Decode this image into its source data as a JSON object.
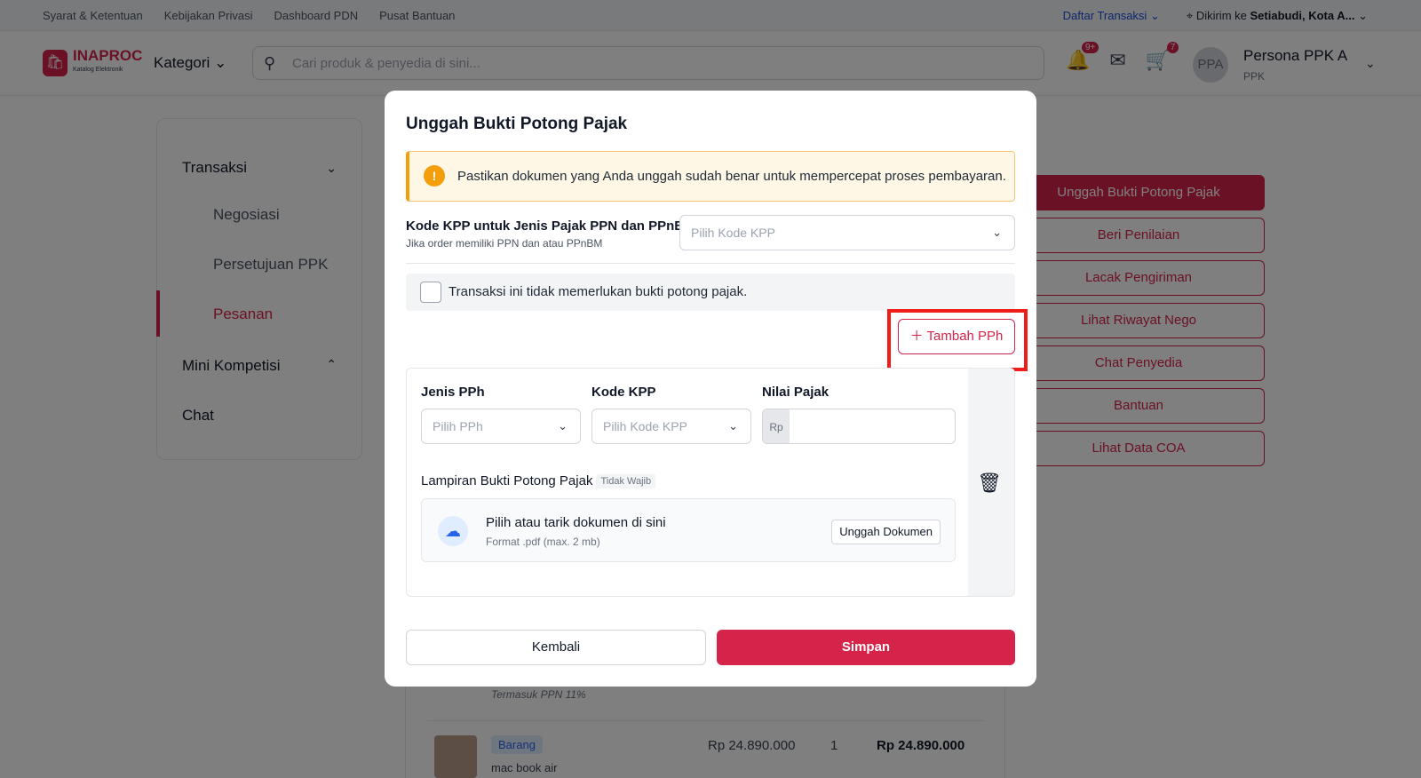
{
  "topbar": {
    "links": [
      "Syarat & Ketentuan",
      "Kebijakan Privasi",
      "Dashboard PDN",
      "Pusat Bantuan"
    ],
    "transactions": "Daftar Transaksi",
    "ship_prefix": "Dikirim ke",
    "ship_to": "Setiabudi, Kota A..."
  },
  "header": {
    "logo": "INAPROC",
    "logo_sub": "Katalog Elektronik",
    "category": "Kategori",
    "search_placeholder": "Cari produk & penyedia di sini...",
    "notif_badge": "9+",
    "cart_badge": "7",
    "avatar": "PPA",
    "user_name": "Persona PPK A",
    "user_role": "PPK"
  },
  "sidebar": {
    "transaksi": "Transaksi",
    "negosiasi": "Negosiasi",
    "persetujuan": "Persetujuan PPK",
    "pesanan": "Pesanan",
    "mini": "Mini Kompetisi",
    "chat": "Chat"
  },
  "actions": [
    "Unggah Bukti Potong Pajak",
    "Beri Penilaian",
    "Lacak Pengiriman",
    "Lihat Riwayat Nego",
    "Chat Penyedia",
    "Bantuan",
    "Lihat Data COA"
  ],
  "product": {
    "ppn_note": "Termasuk PPN 11%",
    "tag": "Barang",
    "name": "mac book air",
    "price": "Rp 24.890.000",
    "qty": "1",
    "total": "Rp 24.890.000"
  },
  "modal": {
    "title": "Unggah Bukti Potong Pajak",
    "alert": "Pastikan dokumen yang Anda unggah sudah benar untuk mempercepat proses pembayaran.",
    "kpp_label": "Kode KPP untuk Jenis Pajak PPN dan PPnBM",
    "kpp_sub": "Jika order memiliki PPN dan atau PPnBM",
    "kpp_placeholder": "Pilih Kode KPP",
    "no_need": "Transaksi ini tidak memerlukan bukti potong pajak.",
    "add_pph": "Tambah PPh",
    "jenis_label": "Jenis PPh",
    "jenis_placeholder": "Pilih PPh",
    "kode_label": "Kode KPP",
    "kode_placeholder": "Pilih Kode KPP",
    "nilai_label": "Nilai Pajak",
    "currency": "Rp",
    "lampiran": "Lampiran Bukti Potong Pajak",
    "optional": "Tidak Wajib",
    "upload_title": "Pilih atau tarik dokumen di sini",
    "upload_format": "Format .pdf (max. 2 mb)",
    "upload_btn": "Unggah Dokumen",
    "back": "Kembali",
    "save": "Simpan"
  }
}
